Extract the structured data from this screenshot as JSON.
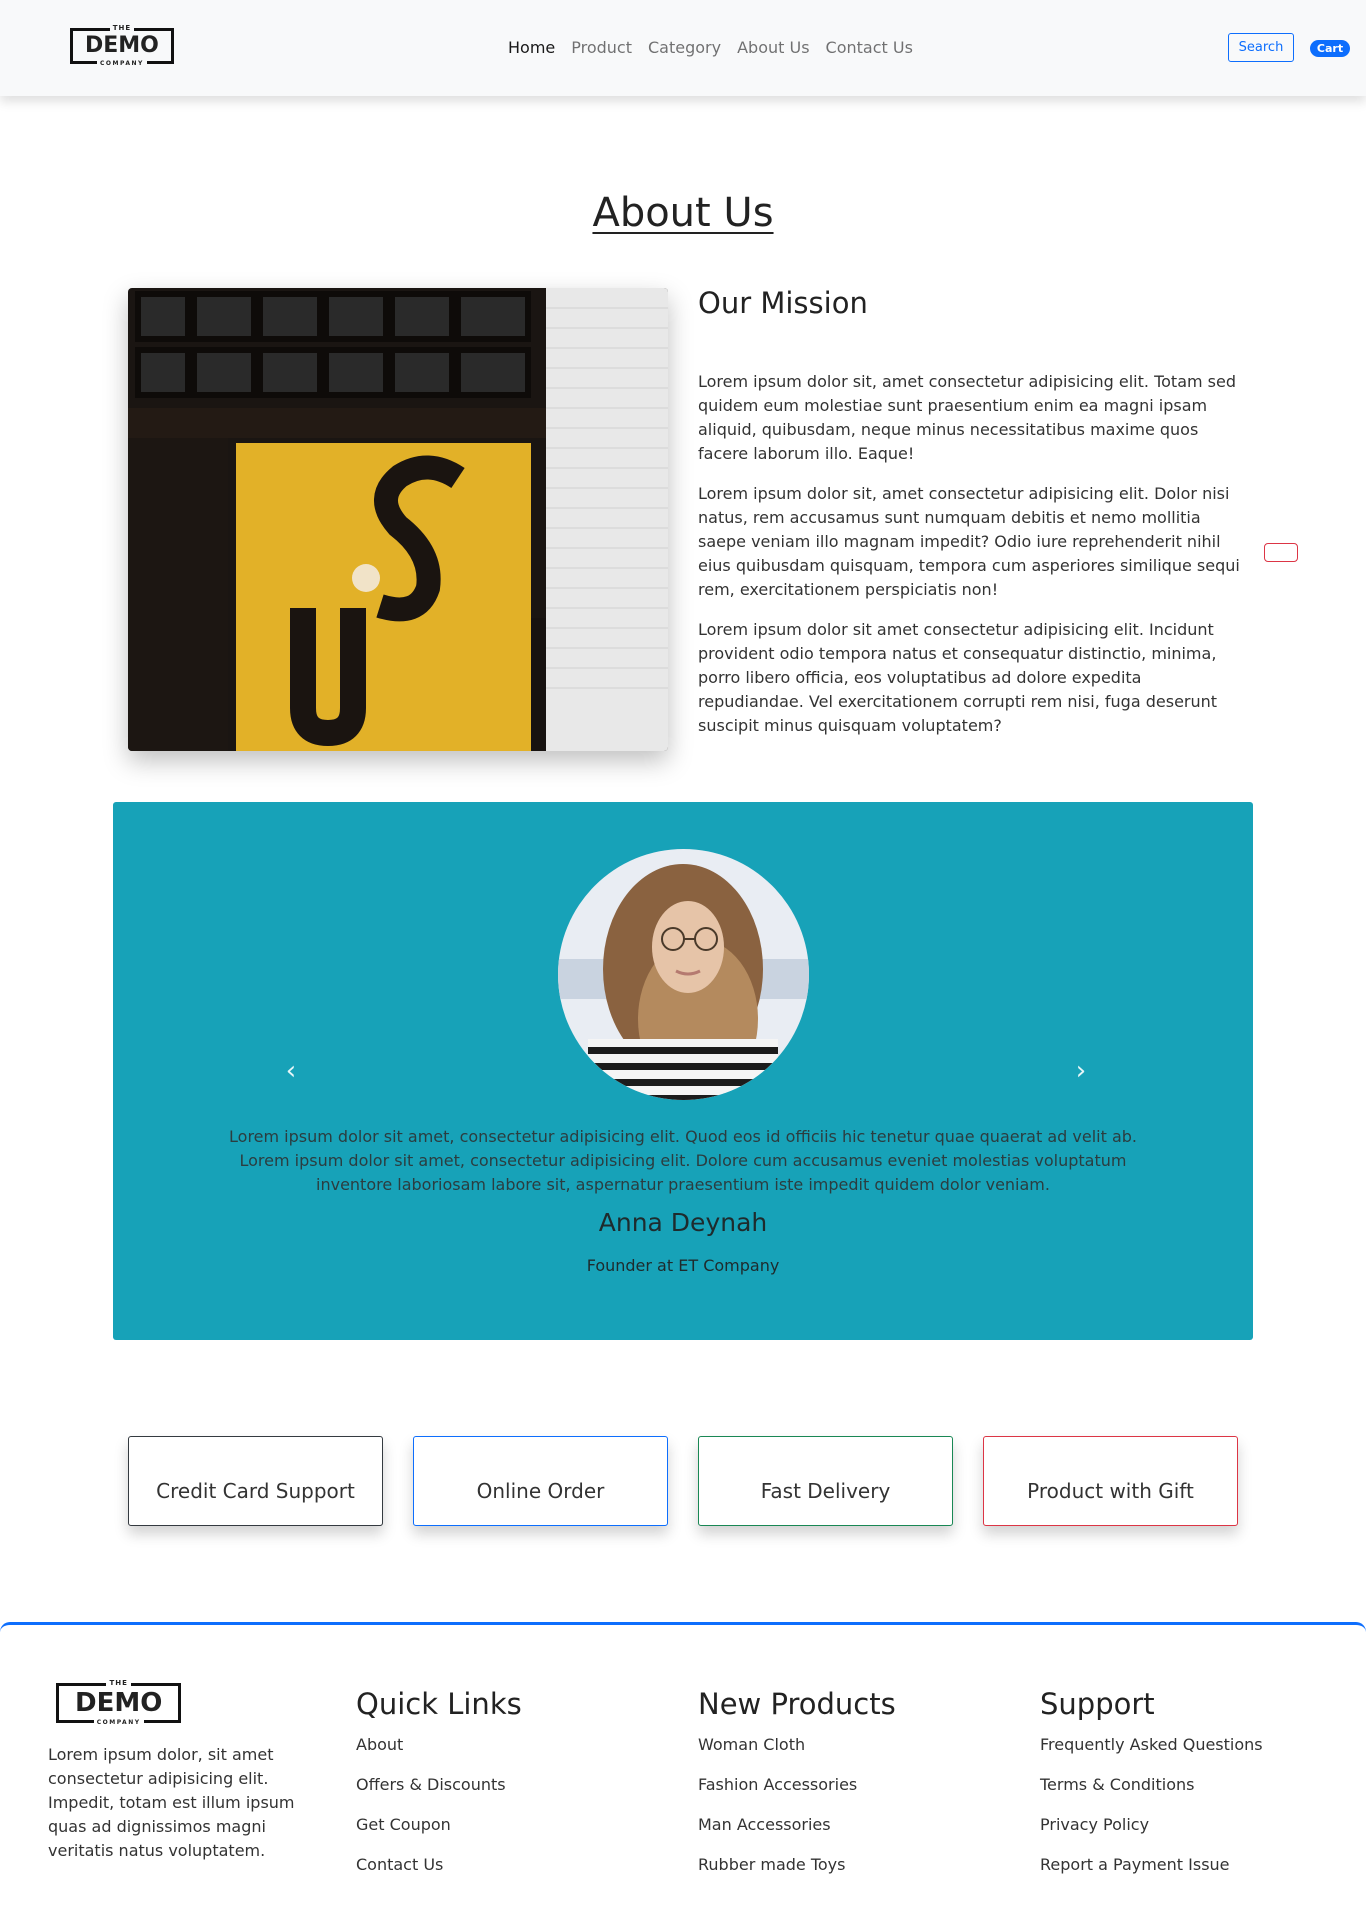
{
  "brand": {
    "the": "THE",
    "name": "DEMO",
    "company": "COMPANY"
  },
  "nav": {
    "links": [
      "Home",
      "Product",
      "Category",
      "About Us",
      "Contact Us"
    ],
    "search_label": "Search",
    "cart_label": "Cart"
  },
  "about": {
    "title": "About Us",
    "mission_title": "Our Mission",
    "paragraphs": [
      "Lorem ipsum dolor sit, amet consectetur adipisicing elit. Totam sed quidem eum molestiae sunt praesentium enim ea magni ipsam aliquid, quibusdam, neque minus necessitatibus maxime quos facere laborum illo. Eaque!",
      "Lorem ipsum dolor sit, amet consectetur adipisicing elit. Dolor nisi natus, rem accusamus sunt numquam debitis et nemo mollitia saepe veniam illo magnam impedit? Odio iure reprehenderit nihil eius quibusdam quisquam, tempora cum asperiores similique sequi rem, exercitationem perspiciatis non!",
      "Lorem ipsum dolor sit amet consectetur adipisicing elit. Incidunt provident odio tempora natus et consequatur distinctio, minima, porro libero officia, eos voluptatibus ad dolore expedita repudiandae. Vel exercitationem corrupti rem nisi, fuga deserunt suscipit minus quisquam voluptatem?"
    ]
  },
  "testimonial": {
    "quote": "Lorem ipsum dolor sit amet, consectetur adipisicing elit. Quod eos id officiis hic tenetur quae quaerat ad velit ab. Lorem ipsum dolor sit amet, consectetur adipisicing elit. Dolore cum accusamus eveniet molestias voluptatum inventore laboriosam labore sit, aspernatur praesentium iste impedit quidem dolor veniam.",
    "name": "Anna Deynah",
    "role": "Founder at ET Company",
    "prev_icon": "chevron-left-icon",
    "next_icon": "chevron-right-icon"
  },
  "features": [
    "Credit Card Support",
    "Online Order",
    "Fast Delivery",
    "Product with Gift"
  ],
  "footer": {
    "about": "Lorem ipsum dolor, sit amet consectetur adipisicing elit. Impedit, totam est illum ipsum quas ad dignissimos magni veritatis natus voluptatem.",
    "quick_links": {
      "title": "Quick Links",
      "items": [
        "About",
        "Offers & Discounts",
        "Get Coupon",
        "Contact Us"
      ]
    },
    "new_products": {
      "title": "New Products",
      "items": [
        "Woman Cloth",
        "Fashion Accessories",
        "Man Accessories",
        "Rubber made Toys"
      ]
    },
    "support": {
      "title": "Support",
      "items": [
        "Frequently Asked Questions",
        "Terms & Conditions",
        "Privacy Policy",
        "Report a Payment Issue"
      ]
    }
  },
  "colors": {
    "primary": "#0d6efd",
    "teal": "#17a2b8",
    "success": "#198754",
    "danger": "#dc3545",
    "dark": "#343a40"
  }
}
